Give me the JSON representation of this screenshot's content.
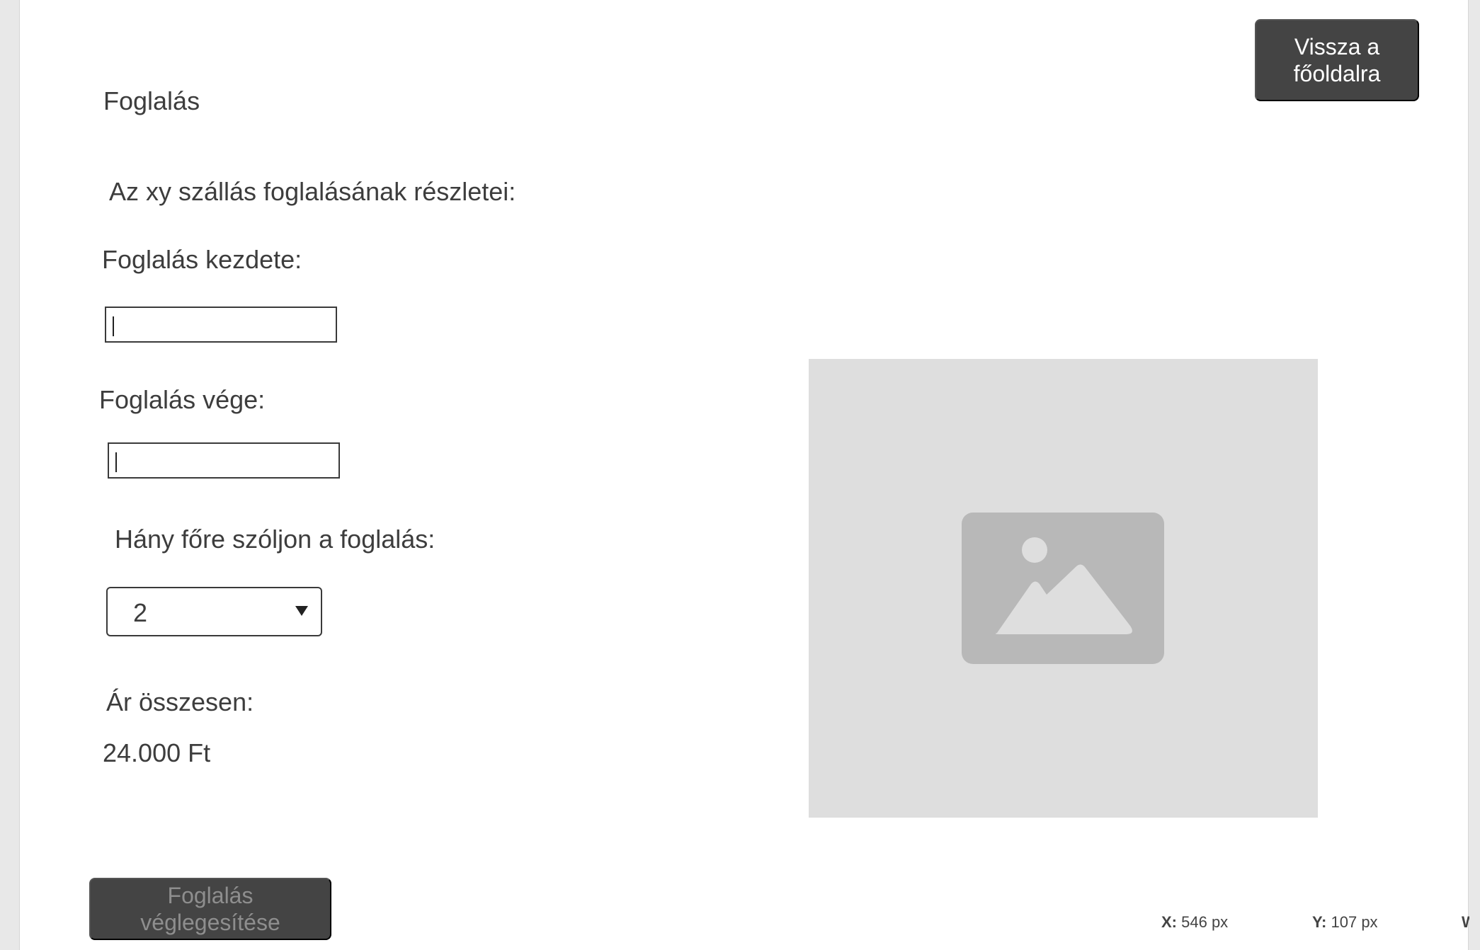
{
  "page": {
    "title": "Foglalás",
    "subtitle": "Az xy szállás foglalásának részletei:"
  },
  "header": {
    "back_button_label": "Vissza a\nfőoldalra"
  },
  "form": {
    "start_label": "Foglalás kezdete:",
    "start_value": "",
    "end_label": "Foglalás vége:",
    "end_value": "",
    "guests_label": "Hány főre szóljon a foglalás:",
    "guests_selected": "2",
    "price_label": "Ár összesen:",
    "price_value": "24.000 Ft",
    "submit_label": "Foglalás\nvéglegesítése"
  },
  "image": {
    "icon": "image-placeholder-icon"
  },
  "status_bar": {
    "x_label": "X:",
    "x_value": "546 px",
    "y_label": "Y:",
    "y_value": "107 px",
    "w_label": "W:"
  },
  "colors": {
    "button_bg": "#444444",
    "placeholder_bg": "#dedede",
    "placeholder_icon": "#b8b8b8"
  }
}
